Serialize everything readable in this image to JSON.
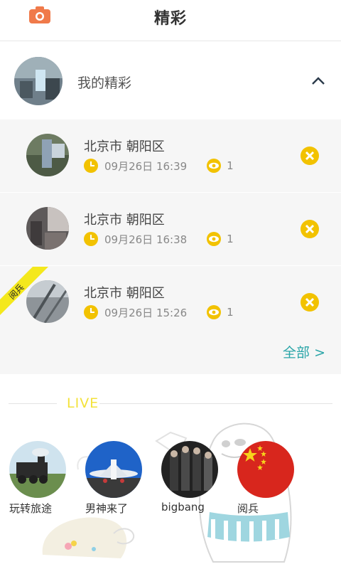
{
  "header": {
    "title": "精彩",
    "camera_icon": "camera-icon"
  },
  "my_section": {
    "label": "我的精彩",
    "toggle_icon": "chevron-up-icon"
  },
  "items": [
    {
      "location": "北京市 朝阳区",
      "time": "09月26日 16:39",
      "views": "1"
    },
    {
      "location": "北京市 朝阳区",
      "time": "09月26日 16:38",
      "views": "1"
    },
    {
      "location": "北京市 朝阳区",
      "time": "09月26日 15:26",
      "views": "1",
      "ribbon": "阅兵"
    }
  ],
  "view_all": "全部 >",
  "live": {
    "heading": "LIVE",
    "topics": [
      {
        "label": "玩转旅途"
      },
      {
        "label": "男神来了"
      },
      {
        "label": "bigbang"
      },
      {
        "label": "阅兵"
      }
    ]
  },
  "colors": {
    "accent_yellow": "#f2c200",
    "camera_orange": "#f07a4a",
    "link_teal": "#2aa5a8",
    "live_yellow": "#f3e23a"
  }
}
